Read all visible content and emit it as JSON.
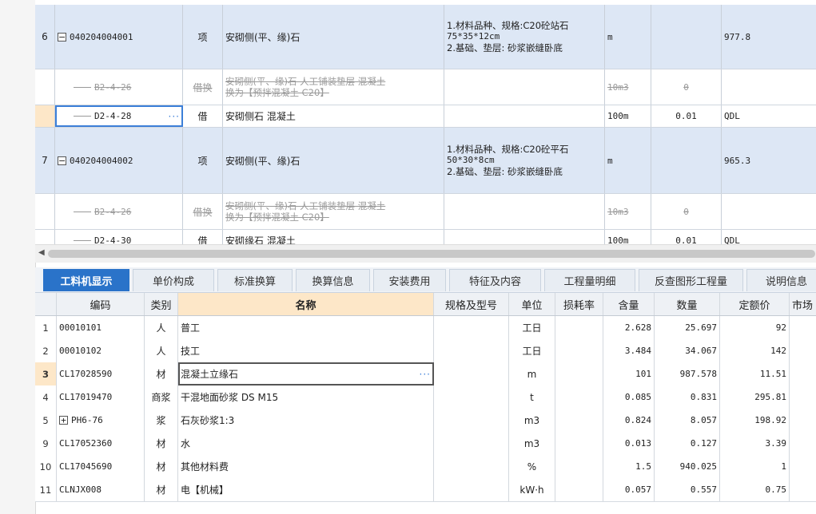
{
  "upper_rows": [
    {
      "kind": "main",
      "num": "6",
      "code": "040204004001",
      "cat": "项",
      "name": "安砌侧(平、缘)石",
      "features": [
        "1.材料品种、规格:C20砼站石",
        "75*35*12cm",
        "2.基础、垫层: 砂浆嵌缝卧底"
      ],
      "unit": "m",
      "qty": "",
      "q2": "977.8"
    },
    {
      "kind": "struck",
      "num": "",
      "code": "B2-4-26",
      "cat": "借换",
      "name_lines": [
        "安砌侧(平、缘)石 人工铺装垫层 混凝土",
        "换为【预拌混凝土 C20】"
      ],
      "unit": "10m3",
      "qty": "0",
      "q2": ""
    },
    {
      "kind": "sub",
      "num": "",
      "code": "D2-4-28",
      "cat": "借",
      "name": "安砌侧石 混凝土",
      "unit": "100m",
      "qty": "0.01",
      "q2": "QDL",
      "selected": true,
      "dots": "···"
    },
    {
      "kind": "main",
      "num": "7",
      "code": "040204004002",
      "cat": "项",
      "name": "安砌侧(平、缘)石",
      "features": [
        "1.材料品种、规格:C20砼平石",
        "50*30*8cm",
        "2.基础、垫层: 砂浆嵌缝卧底"
      ],
      "unit": "m",
      "qty": "",
      "q2": "965.3"
    },
    {
      "kind": "struck",
      "num": "",
      "code": "B2-4-26",
      "cat": "借换",
      "name_lines": [
        "安砌侧(平、缘)石 人工铺装垫层 混凝土",
        "换为【预拌混凝土 C20】"
      ],
      "unit": "10m3",
      "qty": "0",
      "q2": ""
    },
    {
      "kind": "sub",
      "num": "",
      "code": "D2-4-30",
      "cat": "借",
      "name": "安砌缘石 混凝土",
      "unit": "100m",
      "qty": "0.01",
      "q2": "QDL"
    }
  ],
  "tabs": [
    "工料机显示",
    "单价构成",
    "标准换算",
    "换算信息",
    "安装费用",
    "特征及内容",
    "工程量明细",
    "反查图形工程量",
    "说明信息"
  ],
  "active_tab": 0,
  "columns": {
    "code": "编码",
    "cat": "类别",
    "name": "名称",
    "spec": "规格及型号",
    "unit": "单位",
    "loss": "损耗率",
    "amount": "含量",
    "qty": "数量",
    "price": "定额价",
    "market": "市场"
  },
  "resources": [
    {
      "no": "1",
      "code": "00010101",
      "cat": "人",
      "name": "普工",
      "spec": "",
      "unit": "工日",
      "loss": "",
      "amount": "2.628",
      "qty": "25.697",
      "price": "92",
      "market": ""
    },
    {
      "no": "2",
      "code": "00010102",
      "cat": "人",
      "name": "技工",
      "spec": "",
      "unit": "工日",
      "loss": "",
      "amount": "3.484",
      "qty": "34.067",
      "price": "142",
      "market": ""
    },
    {
      "no": "3",
      "code": "CL17028590",
      "cat": "材",
      "name": "混凝土立缘石",
      "spec": "",
      "unit": "m",
      "loss": "",
      "amount": "101",
      "qty": "987.578",
      "price": "11.51",
      "market": "",
      "selected": true,
      "dots": "···"
    },
    {
      "no": "4",
      "code": "CL17019470",
      "cat": "商浆",
      "name": "干混地面砂浆 DS M15",
      "spec": "",
      "unit": "t",
      "loss": "",
      "amount": "0.085",
      "qty": "0.831",
      "price": "295.81",
      "market": "31"
    },
    {
      "no": "5",
      "code": "PH6-76",
      "cat": "浆",
      "name": "石灰砂浆1:3",
      "spec": "",
      "unit": "m3",
      "loss": "",
      "amount": "0.824",
      "qty": "8.057",
      "price": "198.92",
      "market": "39",
      "expand": "+"
    },
    {
      "no": "9",
      "code": "CL17052360",
      "cat": "材",
      "name": "水",
      "spec": "",
      "unit": "m3",
      "loss": "",
      "amount": "0.013",
      "qty": "0.127",
      "price": "3.39",
      "market": ""
    },
    {
      "no": "10",
      "code": "CL17045690",
      "cat": "材",
      "name": "其他材料费",
      "spec": "",
      "unit": "%",
      "loss": "",
      "amount": "1.5",
      "qty": "940.025",
      "price": "1",
      "market": ""
    },
    {
      "no": "11",
      "code": "CLNJX008",
      "cat": "材",
      "name": "电【机械】",
      "spec": "",
      "unit": "kW·h",
      "loss": "",
      "amount": "0.057",
      "qty": "0.557",
      "price": "0.75",
      "market": ""
    }
  ]
}
